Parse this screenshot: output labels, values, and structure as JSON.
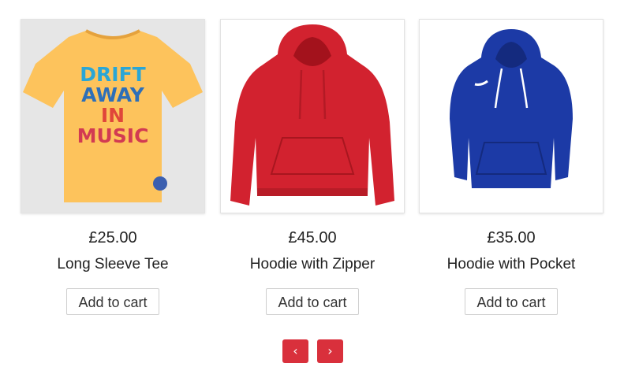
{
  "products": [
    {
      "price": "£25.00",
      "title": "Long Sleeve Tee",
      "add_label": "Add to cart",
      "image": "yellow-graphic-tshirt",
      "print_lines": [
        "DRIFT",
        "AWAY",
        "IN",
        "MUSIC"
      ]
    },
    {
      "price": "£45.00",
      "title": "Hoodie with Zipper",
      "add_label": "Add to cart",
      "image": "red-hoodie"
    },
    {
      "price": "£35.00",
      "title": "Hoodie with Pocket",
      "add_label": "Add to cart",
      "image": "blue-hoodie"
    }
  ],
  "nav": {
    "prev_label": "‹",
    "next_label": "›"
  },
  "colors": {
    "nav_accent": "#d9303c",
    "tee": "#fdc35c",
    "red_hoodie": "#d2222f",
    "blue_hoodie": "#1c3aa6"
  }
}
